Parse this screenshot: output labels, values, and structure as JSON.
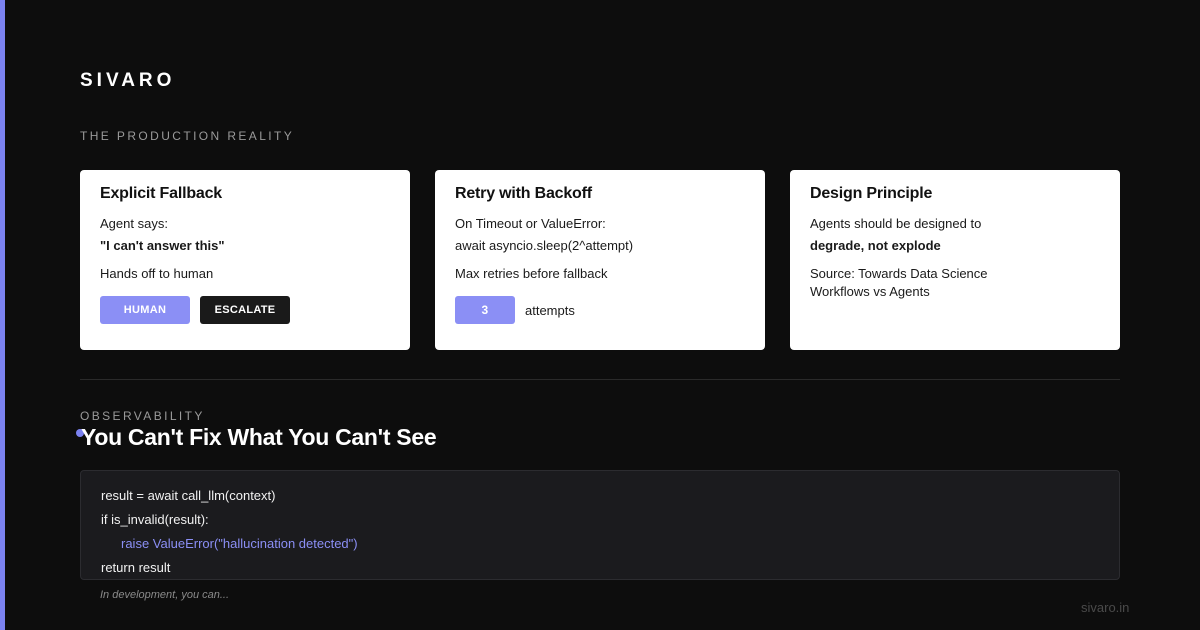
{
  "brand": "SIVARO",
  "section_label": "THE PRODUCTION REALITY",
  "cards": [
    {
      "title": "Explicit Fallback",
      "line1": "Agent says:",
      "line2": "\"I can't answer this\"",
      "line3": "Hands off to human",
      "buttons": [
        "HUMAN",
        "ESCALATE"
      ]
    },
    {
      "title": "Retry with Backoff",
      "line1": "On Timeout or ValueError:",
      "line2": "await asyncio.sleep(2^attempt)",
      "line3": "Max retries before fallback",
      "count": "3",
      "count_label": "attempts"
    },
    {
      "title": "Design Principle",
      "line1": "Agents should be designed to",
      "line2": "degrade, not explode",
      "line3": "Source: Towards Data Science",
      "line4": "Workflows vs Agents"
    }
  ],
  "observability_label": "OBSERVABILITY",
  "headline": "You Can't Fix What You Can't See",
  "code": [
    "result = await call_llm(context)",
    "if is_invalid(result):",
    "raise ValueError(\"hallucination detected\")",
    "return result"
  ],
  "note": "In development, you can...",
  "footer": "sivaro.in",
  "colors": {
    "accent": "#7b82f0",
    "button_accent": "#8b8ff5",
    "background": "#0d0d0d",
    "card": "#ffffff"
  }
}
